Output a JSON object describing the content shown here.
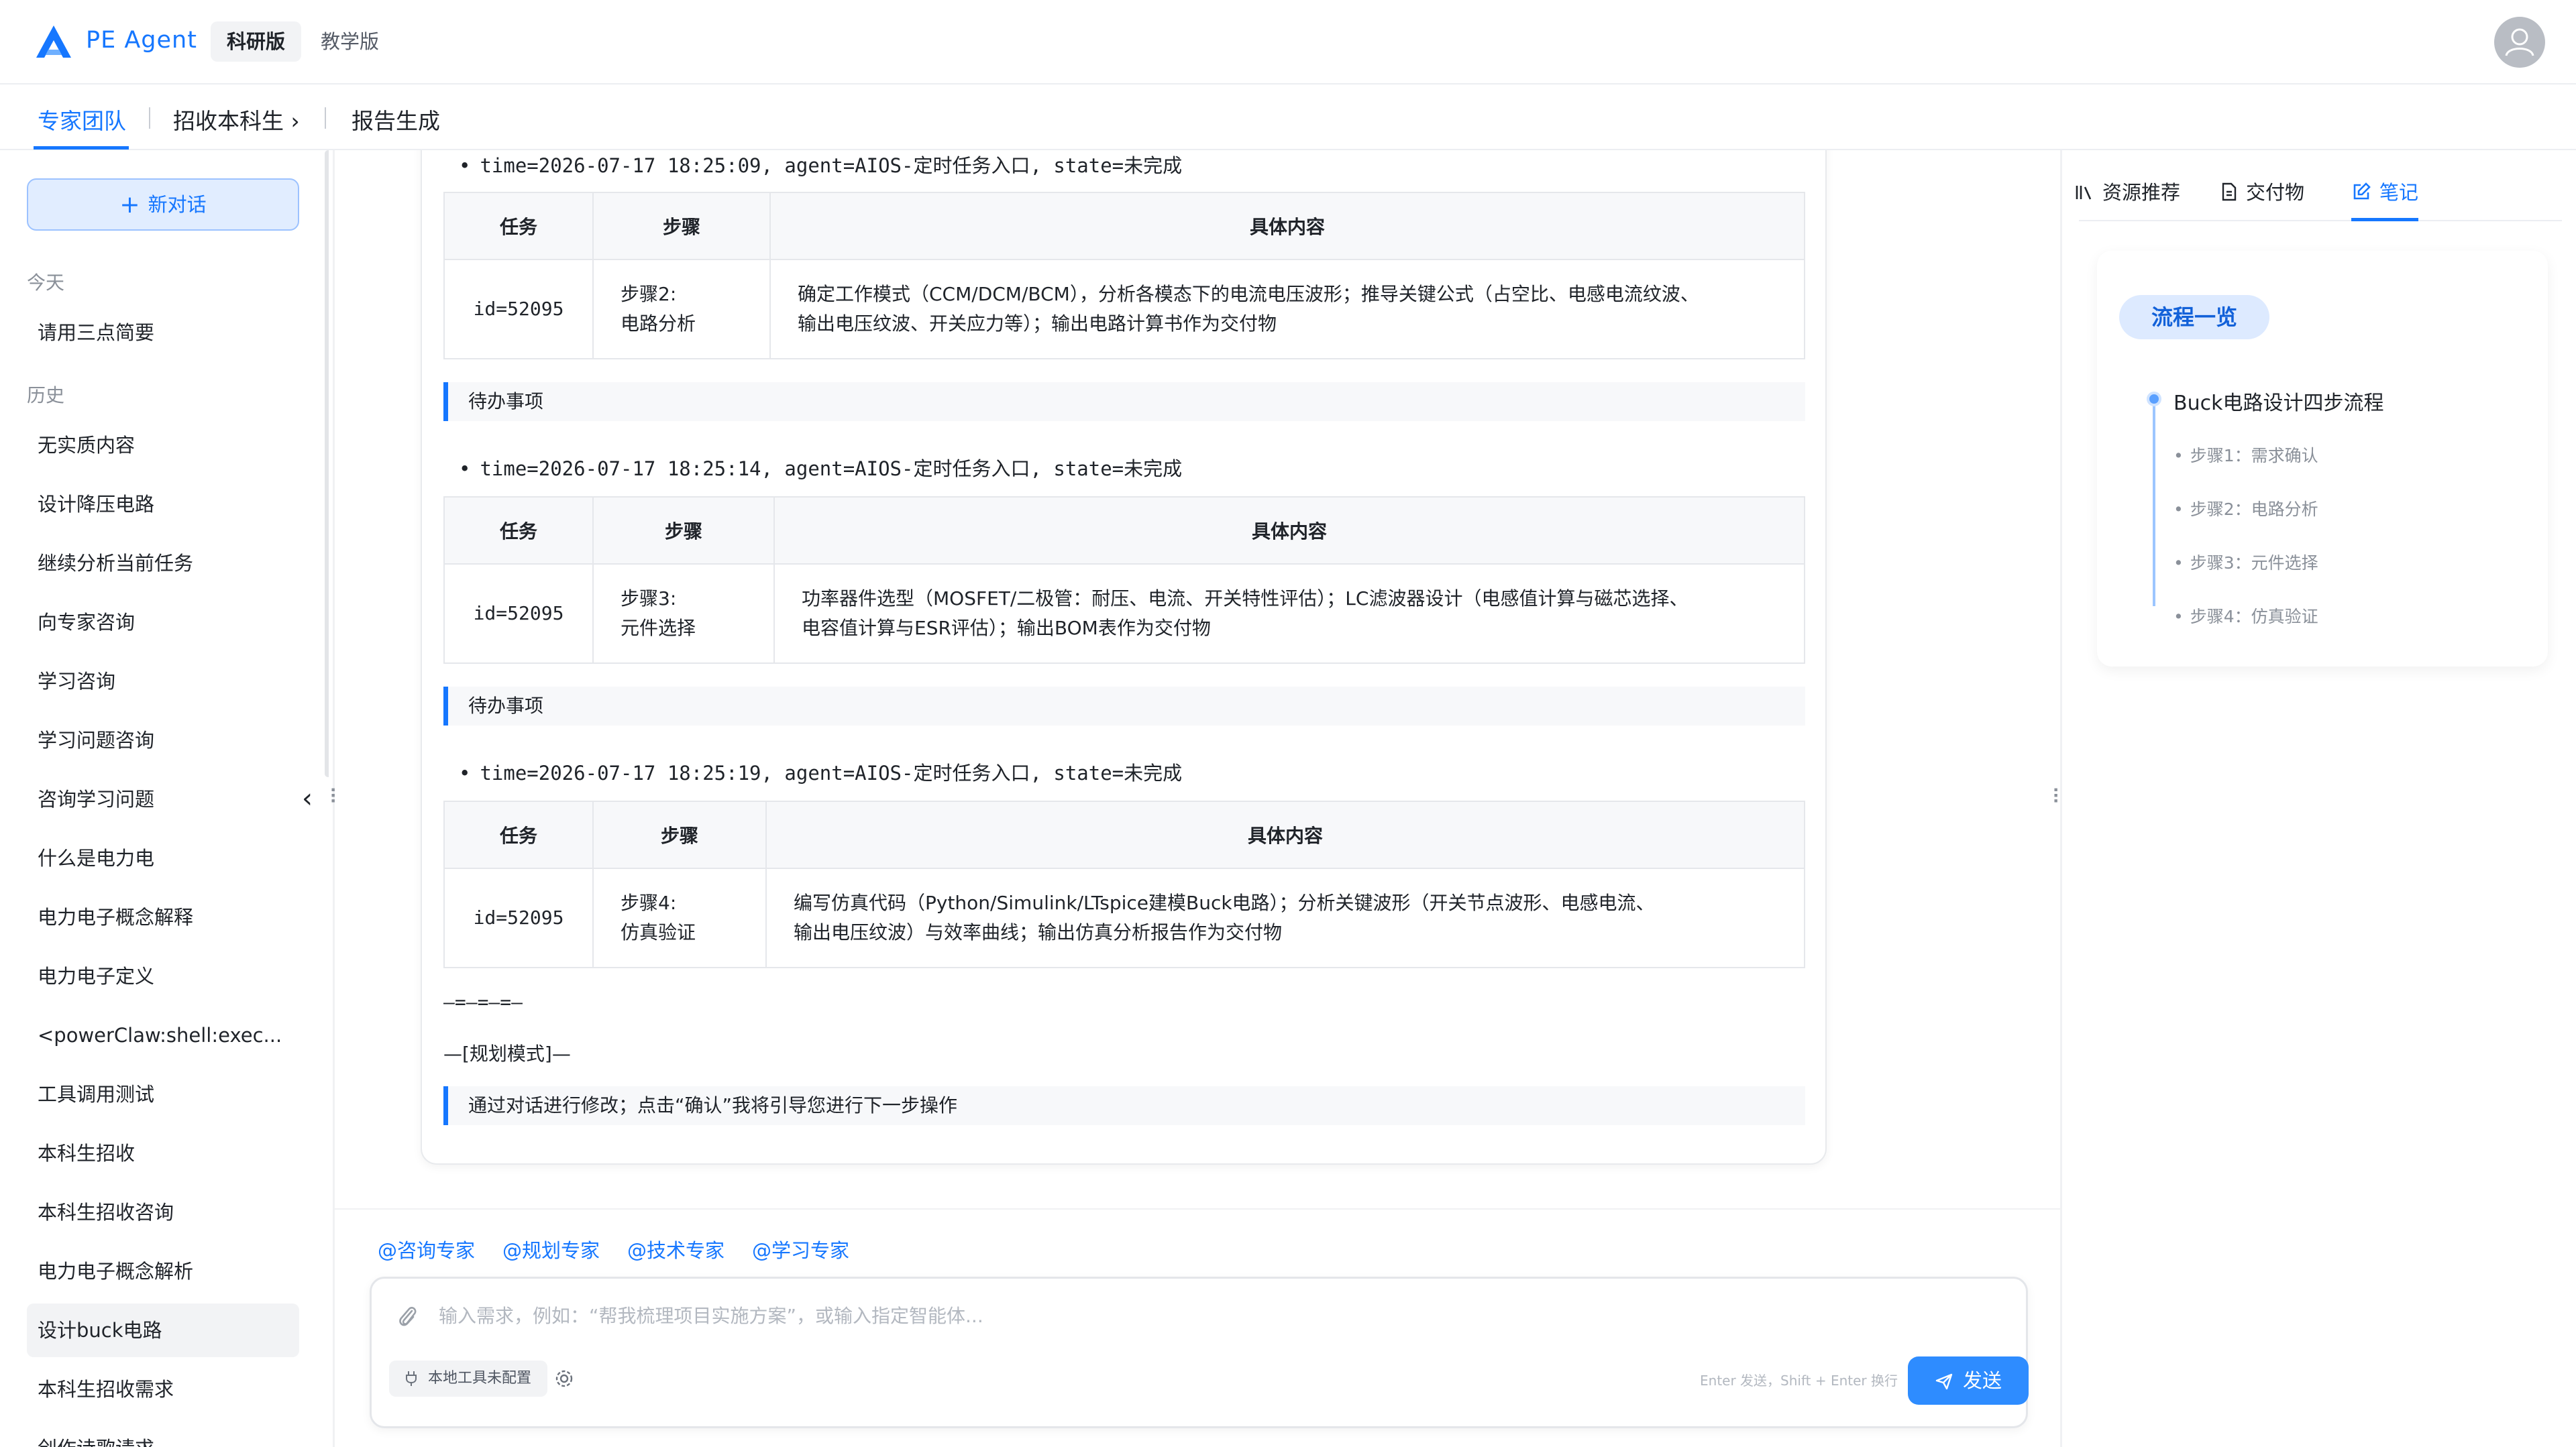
{
  "header": {
    "app_name": "PE Agent",
    "tabs": [
      {
        "label": "科研版",
        "active": true
      },
      {
        "label": "教学版",
        "active": false
      }
    ]
  },
  "breadcrumb": {
    "items": [
      {
        "label": "专家团队",
        "active": true
      },
      {
        "label": "招收本科生 ›"
      },
      {
        "label": "报告生成"
      }
    ]
  },
  "sidebar": {
    "new_chat_label": "新对话",
    "today_label": "今天",
    "today_items": [
      "请用三点简要"
    ],
    "history_label": "历史",
    "history_items": [
      "无实质内容",
      "设计降压电路",
      "继续分析当前任务",
      "向专家咨询",
      "学习咨询",
      "学习问题咨询",
      "咨询学习问题",
      "什么是电力电",
      "电力电子概念解释",
      "电力电子定义",
      "<powerClaw:shell:exec...",
      "工具调用测试",
      "本科生招收",
      "本科生招收咨询",
      "电力电子概念解析",
      "设计buck电路",
      "本科生招收需求",
      "创作诗歌请求"
    ],
    "selected_item": "设计buck电路"
  },
  "chat": {
    "bullets": [
      "time=2026-07-17 18:25:09, agent=AIOS-定时任务入口, state=未完成",
      "time=2026-07-17 18:25:14, agent=AIOS-定时任务入口, state=未完成",
      "time=2026-07-17 18:25:19, agent=AIOS-定时任务入口, state=未完成"
    ],
    "table_headers": [
      "任务",
      "步骤",
      "具体内容"
    ],
    "tables": [
      {
        "id": "id=52095",
        "step_line1": "步骤2:",
        "step_line2": "电路分析",
        "content_line1": "确定工作模式（CCM/DCM/BCM），分析各模态下的电流电压波形；推导关键公式（占空比、电感电流纹波、",
        "content_line2": "输出电压纹波、开关应力等）；输出电路计算书作为交付物"
      },
      {
        "id": "id=52095",
        "step_line1": "步骤3:",
        "step_line2": "元件选择",
        "content_line1": "功率器件选型（MOSFET/二极管：耐压、电流、开关特性评估）；LC滤波器设计（电感值计算与磁芯选择、",
        "content_line2": "电容值计算与ESR评估）；输出BOM表作为交付物"
      },
      {
        "id": "id=52095",
        "step_line1": "步骤4:",
        "step_line2": "仿真验证",
        "content_line1": "编写仿真代码（Python/Simulink/LTspice建模Buck电路）；分析关键波形（开关节点波形、电感电流、",
        "content_line2": "输出电压纹波）与效率曲线；输出仿真分析报告作为交付物"
      }
    ],
    "todo_label": "待办事项",
    "separator": "—=—=—=—",
    "mode_label": "—[规划模式]—",
    "instruction": "通过对话进行修改；点击“确认”我将引导您进行下一步操作"
  },
  "composer": {
    "mentions": [
      "@咨询专家",
      "@规划专家",
      "@技术专家",
      "@学习专家"
    ],
    "placeholder": "输入需求，例如：“帮我梳理项目实施方案”，或输入指定智能体...",
    "tool_chip": "本地工具未配置",
    "hint": "Enter 发送，Shift + Enter 换行",
    "send_label": "发送"
  },
  "right_panel": {
    "tabs": [
      {
        "label": "资源推荐",
        "icon": "library-icon"
      },
      {
        "label": "交付物",
        "icon": "document-icon"
      },
      {
        "label": "笔记",
        "icon": "note-edit-icon",
        "active": true
      }
    ],
    "flow_pill": "流程一览",
    "flow_title": "Buck电路设计四步流程",
    "flow_steps": [
      "步骤1：需求确认",
      "步骤2：电路分析",
      "步骤3：元件选择",
      "步骤4：仿真验证"
    ]
  },
  "colors": {
    "accent": "#1677ff",
    "accent_light": "#e1edff",
    "border": "#e5e7eb"
  }
}
